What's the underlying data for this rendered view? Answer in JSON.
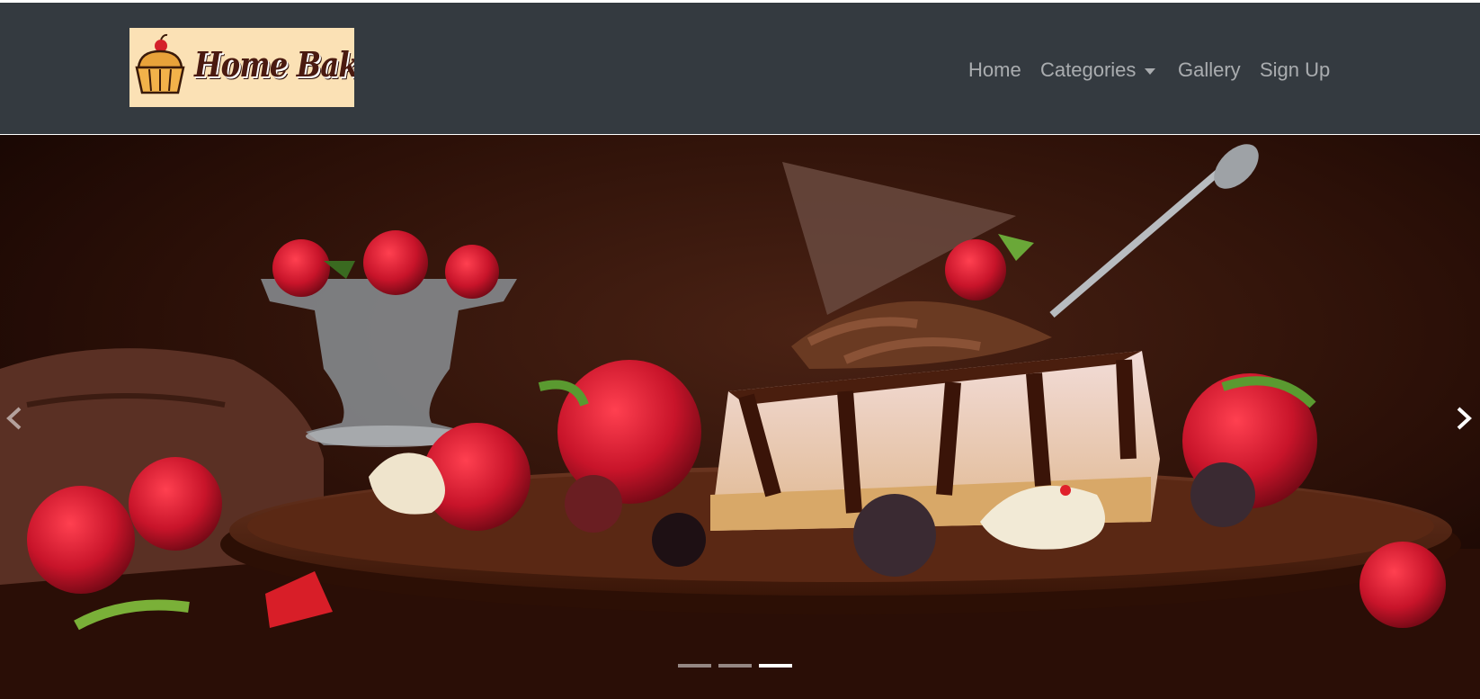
{
  "brand": {
    "logo_text": "Home Bakery",
    "logo_icon": "cupcake-icon",
    "background_color": "#fbe1b5"
  },
  "nav": {
    "items": [
      {
        "label": "Home"
      },
      {
        "label": "Categories"
      },
      {
        "label": "Gallery"
      },
      {
        "label": "Sign Up"
      }
    ],
    "categories_icon": "caret-down-icon",
    "background_color": "#343a40"
  },
  "carousel": {
    "slide_count": 3,
    "active_slide": 3,
    "prev_icon": "chevron-left-icon",
    "next_icon": "chevron-right-icon",
    "image": "chocolate-cheesecake-with-strawberries"
  }
}
